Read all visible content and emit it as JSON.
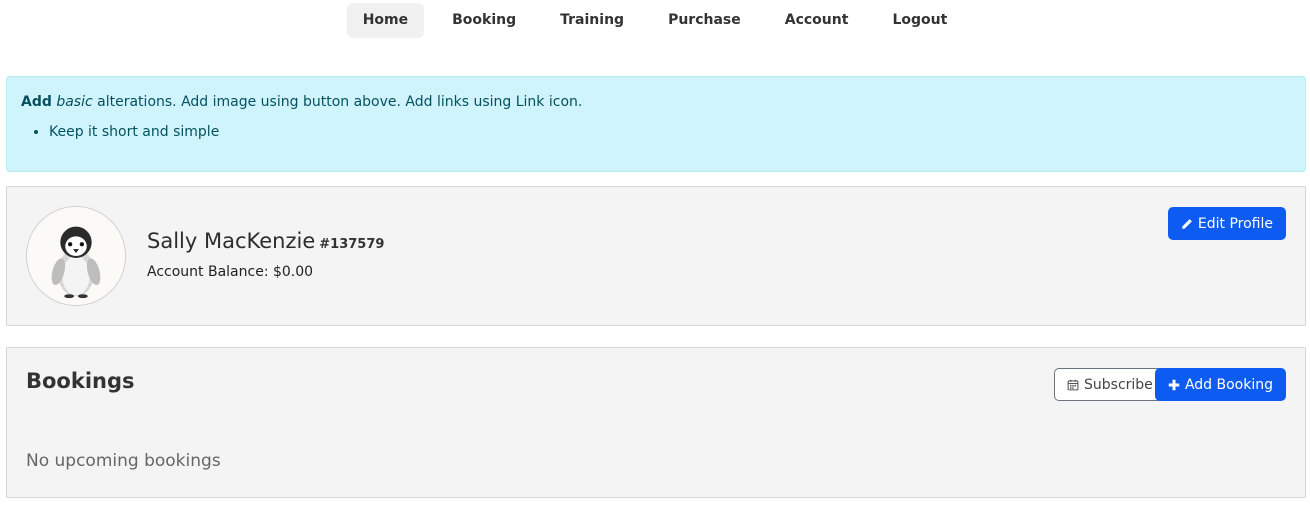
{
  "nav": {
    "items": [
      {
        "label": "Home",
        "active": true
      },
      {
        "label": "Booking",
        "active": false
      },
      {
        "label": "Training",
        "active": false
      },
      {
        "label": "Purchase",
        "active": false
      },
      {
        "label": "Account",
        "active": false
      },
      {
        "label": "Logout",
        "active": false
      }
    ]
  },
  "alert": {
    "bold_word": "Add",
    "italic_word": "basic",
    "rest": " alterations. Add image using button above. Add links using Link icon.",
    "bullet": "Keep it short and simple"
  },
  "profile": {
    "name": "Sally MacKenzie",
    "id": "#137579",
    "balance": "Account Balance: $0.00",
    "edit_label": "Edit Profile",
    "avatar_icon": "penguin-avatar"
  },
  "bookings": {
    "title": "Bookings",
    "subscribe_label": "Subscribe",
    "add_label": "Add Booking",
    "empty_text": "No upcoming bookings"
  },
  "colors": {
    "primary": "#0d5bf0",
    "alert_bg": "#cff4fc",
    "alert_text": "#055160",
    "card_bg": "#f4f4f4"
  }
}
